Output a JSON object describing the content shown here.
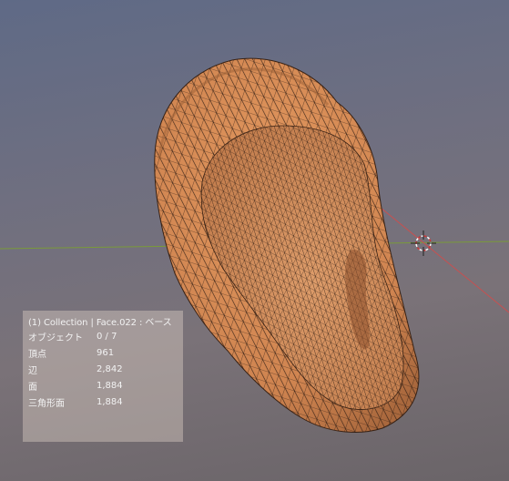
{
  "viewport": {
    "background_top": "#5f6a86",
    "background_bottom": "#6a6468",
    "mesh_color": "#d58a55",
    "wire_color": "#2a1a12",
    "x_axis_color": "#c85050",
    "y_axis_color": "#7a9a3a",
    "object_name": "ear-mesh",
    "cursor_icon": "3d-cursor-icon"
  },
  "overlay": {
    "header": "(1) Collection | Face.022 : ベース",
    "stats": [
      {
        "label": "オブジェクト",
        "value": "0 / 7"
      },
      {
        "label": "頂点",
        "value": "961"
      },
      {
        "label": "辺",
        "value": "2,842"
      },
      {
        "label": "面",
        "value": "1,884"
      },
      {
        "label": "三角形面",
        "value": "1,884"
      }
    ]
  }
}
